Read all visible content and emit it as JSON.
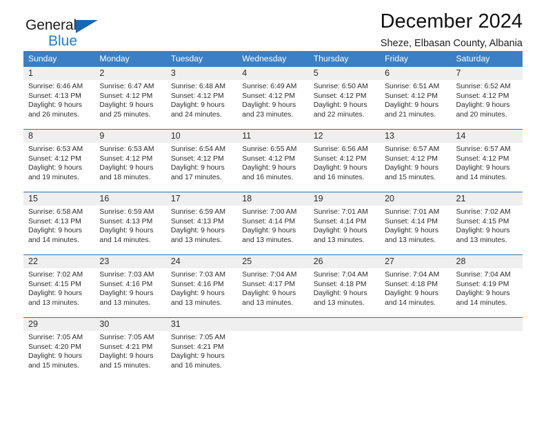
{
  "brand": {
    "name_part1": "General",
    "name_part2": "Blue",
    "accent_color": "#1668b3",
    "triangle_icon": "triangle-icon"
  },
  "header": {
    "month_title": "December 2024",
    "location_subtitle": "Sheze, Elbasan County, Albania"
  },
  "theme": {
    "header_bg": "#3b7fc4",
    "row_divider": "#2e6fb0",
    "day_band": "#efefef",
    "text": "#2b2b2b"
  },
  "weekday_headers": [
    "Sunday",
    "Monday",
    "Tuesday",
    "Wednesday",
    "Thursday",
    "Friday",
    "Saturday"
  ],
  "labels": {
    "sunrise_prefix": "Sunrise:",
    "sunset_prefix": "Sunset:",
    "daylight_prefix": "Daylight:"
  },
  "weeks": [
    [
      {
        "day": "1",
        "sunrise": "Sunrise: 6:46 AM",
        "sunset": "Sunset: 4:13 PM",
        "daylight_line1": "Daylight: 9 hours",
        "daylight_line2": "and 26 minutes."
      },
      {
        "day": "2",
        "sunrise": "Sunrise: 6:47 AM",
        "sunset": "Sunset: 4:12 PM",
        "daylight_line1": "Daylight: 9 hours",
        "daylight_line2": "and 25 minutes."
      },
      {
        "day": "3",
        "sunrise": "Sunrise: 6:48 AM",
        "sunset": "Sunset: 4:12 PM",
        "daylight_line1": "Daylight: 9 hours",
        "daylight_line2": "and 24 minutes."
      },
      {
        "day": "4",
        "sunrise": "Sunrise: 6:49 AM",
        "sunset": "Sunset: 4:12 PM",
        "daylight_line1": "Daylight: 9 hours",
        "daylight_line2": "and 23 minutes."
      },
      {
        "day": "5",
        "sunrise": "Sunrise: 6:50 AM",
        "sunset": "Sunset: 4:12 PM",
        "daylight_line1": "Daylight: 9 hours",
        "daylight_line2": "and 22 minutes."
      },
      {
        "day": "6",
        "sunrise": "Sunrise: 6:51 AM",
        "sunset": "Sunset: 4:12 PM",
        "daylight_line1": "Daylight: 9 hours",
        "daylight_line2": "and 21 minutes."
      },
      {
        "day": "7",
        "sunrise": "Sunrise: 6:52 AM",
        "sunset": "Sunset: 4:12 PM",
        "daylight_line1": "Daylight: 9 hours",
        "daylight_line2": "and 20 minutes."
      }
    ],
    [
      {
        "day": "8",
        "sunrise": "Sunrise: 6:53 AM",
        "sunset": "Sunset: 4:12 PM",
        "daylight_line1": "Daylight: 9 hours",
        "daylight_line2": "and 19 minutes."
      },
      {
        "day": "9",
        "sunrise": "Sunrise: 6:53 AM",
        "sunset": "Sunset: 4:12 PM",
        "daylight_line1": "Daylight: 9 hours",
        "daylight_line2": "and 18 minutes."
      },
      {
        "day": "10",
        "sunrise": "Sunrise: 6:54 AM",
        "sunset": "Sunset: 4:12 PM",
        "daylight_line1": "Daylight: 9 hours",
        "daylight_line2": "and 17 minutes."
      },
      {
        "day": "11",
        "sunrise": "Sunrise: 6:55 AM",
        "sunset": "Sunset: 4:12 PM",
        "daylight_line1": "Daylight: 9 hours",
        "daylight_line2": "and 16 minutes."
      },
      {
        "day": "12",
        "sunrise": "Sunrise: 6:56 AM",
        "sunset": "Sunset: 4:12 PM",
        "daylight_line1": "Daylight: 9 hours",
        "daylight_line2": "and 16 minutes."
      },
      {
        "day": "13",
        "sunrise": "Sunrise: 6:57 AM",
        "sunset": "Sunset: 4:12 PM",
        "daylight_line1": "Daylight: 9 hours",
        "daylight_line2": "and 15 minutes."
      },
      {
        "day": "14",
        "sunrise": "Sunrise: 6:57 AM",
        "sunset": "Sunset: 4:12 PM",
        "daylight_line1": "Daylight: 9 hours",
        "daylight_line2": "and 14 minutes."
      }
    ],
    [
      {
        "day": "15",
        "sunrise": "Sunrise: 6:58 AM",
        "sunset": "Sunset: 4:13 PM",
        "daylight_line1": "Daylight: 9 hours",
        "daylight_line2": "and 14 minutes."
      },
      {
        "day": "16",
        "sunrise": "Sunrise: 6:59 AM",
        "sunset": "Sunset: 4:13 PM",
        "daylight_line1": "Daylight: 9 hours",
        "daylight_line2": "and 14 minutes."
      },
      {
        "day": "17",
        "sunrise": "Sunrise: 6:59 AM",
        "sunset": "Sunset: 4:13 PM",
        "daylight_line1": "Daylight: 9 hours",
        "daylight_line2": "and 13 minutes."
      },
      {
        "day": "18",
        "sunrise": "Sunrise: 7:00 AM",
        "sunset": "Sunset: 4:14 PM",
        "daylight_line1": "Daylight: 9 hours",
        "daylight_line2": "and 13 minutes."
      },
      {
        "day": "19",
        "sunrise": "Sunrise: 7:01 AM",
        "sunset": "Sunset: 4:14 PM",
        "daylight_line1": "Daylight: 9 hours",
        "daylight_line2": "and 13 minutes."
      },
      {
        "day": "20",
        "sunrise": "Sunrise: 7:01 AM",
        "sunset": "Sunset: 4:14 PM",
        "daylight_line1": "Daylight: 9 hours",
        "daylight_line2": "and 13 minutes."
      },
      {
        "day": "21",
        "sunrise": "Sunrise: 7:02 AM",
        "sunset": "Sunset: 4:15 PM",
        "daylight_line1": "Daylight: 9 hours",
        "daylight_line2": "and 13 minutes."
      }
    ],
    [
      {
        "day": "22",
        "sunrise": "Sunrise: 7:02 AM",
        "sunset": "Sunset: 4:15 PM",
        "daylight_line1": "Daylight: 9 hours",
        "daylight_line2": "and 13 minutes."
      },
      {
        "day": "23",
        "sunrise": "Sunrise: 7:03 AM",
        "sunset": "Sunset: 4:16 PM",
        "daylight_line1": "Daylight: 9 hours",
        "daylight_line2": "and 13 minutes."
      },
      {
        "day": "24",
        "sunrise": "Sunrise: 7:03 AM",
        "sunset": "Sunset: 4:16 PM",
        "daylight_line1": "Daylight: 9 hours",
        "daylight_line2": "and 13 minutes."
      },
      {
        "day": "25",
        "sunrise": "Sunrise: 7:04 AM",
        "sunset": "Sunset: 4:17 PM",
        "daylight_line1": "Daylight: 9 hours",
        "daylight_line2": "and 13 minutes."
      },
      {
        "day": "26",
        "sunrise": "Sunrise: 7:04 AM",
        "sunset": "Sunset: 4:18 PM",
        "daylight_line1": "Daylight: 9 hours",
        "daylight_line2": "and 13 minutes."
      },
      {
        "day": "27",
        "sunrise": "Sunrise: 7:04 AM",
        "sunset": "Sunset: 4:18 PM",
        "daylight_line1": "Daylight: 9 hours",
        "daylight_line2": "and 14 minutes."
      },
      {
        "day": "28",
        "sunrise": "Sunrise: 7:04 AM",
        "sunset": "Sunset: 4:19 PM",
        "daylight_line1": "Daylight: 9 hours",
        "daylight_line2": "and 14 minutes."
      }
    ],
    [
      {
        "day": "29",
        "sunrise": "Sunrise: 7:05 AM",
        "sunset": "Sunset: 4:20 PM",
        "daylight_line1": "Daylight: 9 hours",
        "daylight_line2": "and 15 minutes."
      },
      {
        "day": "30",
        "sunrise": "Sunrise: 7:05 AM",
        "sunset": "Sunset: 4:21 PM",
        "daylight_line1": "Daylight: 9 hours",
        "daylight_line2": "and 15 minutes."
      },
      {
        "day": "31",
        "sunrise": "Sunrise: 7:05 AM",
        "sunset": "Sunset: 4:21 PM",
        "daylight_line1": "Daylight: 9 hours",
        "daylight_line2": "and 16 minutes."
      },
      {
        "day": "",
        "sunrise": "",
        "sunset": "",
        "daylight_line1": "",
        "daylight_line2": ""
      },
      {
        "day": "",
        "sunrise": "",
        "sunset": "",
        "daylight_line1": "",
        "daylight_line2": ""
      },
      {
        "day": "",
        "sunrise": "",
        "sunset": "",
        "daylight_line1": "",
        "daylight_line2": ""
      },
      {
        "day": "",
        "sunrise": "",
        "sunset": "",
        "daylight_line1": "",
        "daylight_line2": ""
      }
    ]
  ]
}
